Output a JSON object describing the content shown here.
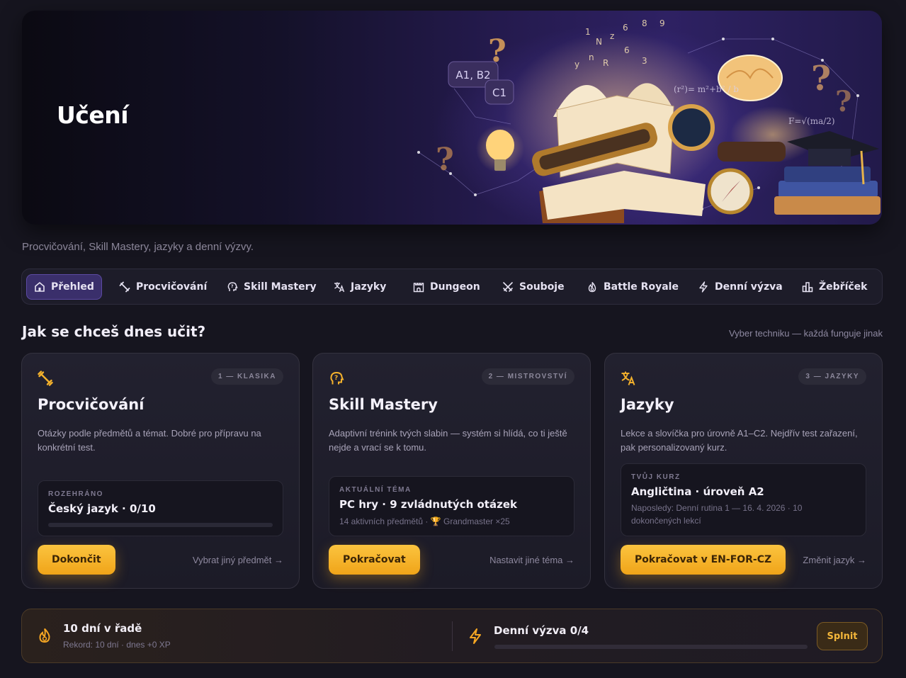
{
  "hero": {
    "title": "Učení"
  },
  "subtitle": "Procvičování, Skill Mastery, jazyky a denní výzvy.",
  "tabs": [
    {
      "label": "Přehled",
      "icon": "home-icon",
      "active": true
    },
    {
      "label": "Procvičování",
      "icon": "dumbbell-icon"
    },
    {
      "label": "Skill Mastery",
      "icon": "brain-head-icon"
    },
    {
      "label": "Jazyky",
      "icon": "translate-icon"
    },
    {
      "label": "Dungeon",
      "icon": "castle-icon"
    },
    {
      "label": "Souboje",
      "icon": "crossed-swords-icon"
    },
    {
      "label": "Battle Royale",
      "icon": "flame-icon"
    },
    {
      "label": "Denní výzva",
      "icon": "lightning-icon"
    },
    {
      "label": "Žebříček",
      "icon": "podium-icon"
    }
  ],
  "section": {
    "title": "Jak se chceš dnes učit?",
    "hint": "Vyber techniku — každá funguje jinak"
  },
  "cards": [
    {
      "badge": "1 — KLASIKA",
      "title": "Procvičování",
      "desc": "Otázky podle předmětů a témat. Dobré pro přípravu na konkrétní test.",
      "box_label": "ROZEHRÁNO",
      "box_value": "Český jazyk · 0/10",
      "progress": 0,
      "button": "Dokončit",
      "link": "Vybrat jiný předmět →"
    },
    {
      "badge": "2 — MISTROVSTVÍ",
      "title": "Skill Mastery",
      "desc": "Adaptivní trénink tvých slabin — systém si hlídá, co ti ještě nejde a vrací se k tomu.",
      "box_label": "AKTUÁLNÍ TÉMA",
      "box_value": "PC hry · 9 zvládnutých otázek",
      "box_meta": "14 aktivních předmětů · 🏆 Grandmaster ×25",
      "button": "Pokračovat",
      "link": "Nastavit jiné téma →"
    },
    {
      "badge": "3 — JAZYKY",
      "title": "Jazyky",
      "desc": "Lekce a slovíčka pro úrovně A1–C2. Nejdřív test zařazení, pak personalizovaný kurz.",
      "box_label": "TVŮJ KURZ",
      "box_value": "Angličtina · úroveň A2",
      "box_meta": "Naposledy: Denní rutina 1 — 16. 4. 2026 · 10 dokončených lekcí",
      "button": "Pokračovat v EN-FOR-CZ",
      "link": "Změnit jazyk →"
    }
  ],
  "streak": {
    "title": "10 dní v řadě",
    "sub": "Rekord: 10 dní · dnes +0 XP",
    "challenge_title": "Denní výzva 0/4",
    "challenge_progress": 0,
    "button": "Splnit"
  },
  "colors": {
    "accent": "#f5b22c",
    "active_tab": "#3a2f6b",
    "background": "#16151f"
  }
}
